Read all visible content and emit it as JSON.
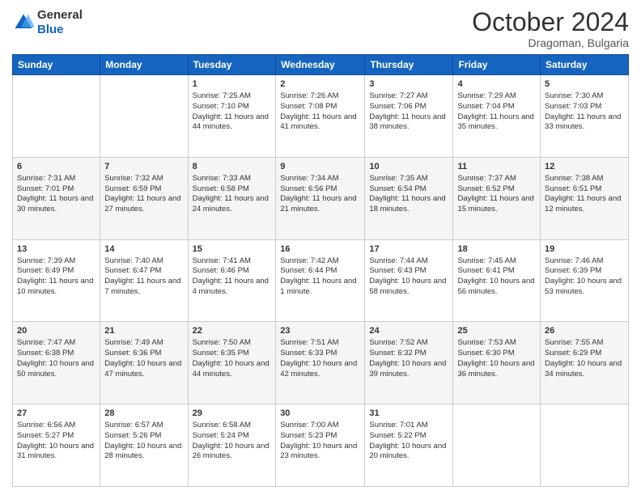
{
  "header": {
    "logo_line1": "General",
    "logo_line2": "Blue",
    "month": "October 2024",
    "location": "Dragoman, Bulgaria"
  },
  "days_of_week": [
    "Sunday",
    "Monday",
    "Tuesday",
    "Wednesday",
    "Thursday",
    "Friday",
    "Saturday"
  ],
  "weeks": [
    [
      {
        "day": "",
        "sunrise": "",
        "sunset": "",
        "daylight": ""
      },
      {
        "day": "",
        "sunrise": "",
        "sunset": "",
        "daylight": ""
      },
      {
        "day": "1",
        "sunrise": "Sunrise: 7:25 AM",
        "sunset": "Sunset: 7:10 PM",
        "daylight": "Daylight: 11 hours and 44 minutes."
      },
      {
        "day": "2",
        "sunrise": "Sunrise: 7:26 AM",
        "sunset": "Sunset: 7:08 PM",
        "daylight": "Daylight: 11 hours and 41 minutes."
      },
      {
        "day": "3",
        "sunrise": "Sunrise: 7:27 AM",
        "sunset": "Sunset: 7:06 PM",
        "daylight": "Daylight: 11 hours and 38 minutes."
      },
      {
        "day": "4",
        "sunrise": "Sunrise: 7:29 AM",
        "sunset": "Sunset: 7:04 PM",
        "daylight": "Daylight: 11 hours and 35 minutes."
      },
      {
        "day": "5",
        "sunrise": "Sunrise: 7:30 AM",
        "sunset": "Sunset: 7:03 PM",
        "daylight": "Daylight: 11 hours and 33 minutes."
      }
    ],
    [
      {
        "day": "6",
        "sunrise": "Sunrise: 7:31 AM",
        "sunset": "Sunset: 7:01 PM",
        "daylight": "Daylight: 11 hours and 30 minutes."
      },
      {
        "day": "7",
        "sunrise": "Sunrise: 7:32 AM",
        "sunset": "Sunset: 6:59 PM",
        "daylight": "Daylight: 11 hours and 27 minutes."
      },
      {
        "day": "8",
        "sunrise": "Sunrise: 7:33 AM",
        "sunset": "Sunset: 6:58 PM",
        "daylight": "Daylight: 11 hours and 24 minutes."
      },
      {
        "day": "9",
        "sunrise": "Sunrise: 7:34 AM",
        "sunset": "Sunset: 6:56 PM",
        "daylight": "Daylight: 11 hours and 21 minutes."
      },
      {
        "day": "10",
        "sunrise": "Sunrise: 7:35 AM",
        "sunset": "Sunset: 6:54 PM",
        "daylight": "Daylight: 11 hours and 18 minutes."
      },
      {
        "day": "11",
        "sunrise": "Sunrise: 7:37 AM",
        "sunset": "Sunset: 6:52 PM",
        "daylight": "Daylight: 11 hours and 15 minutes."
      },
      {
        "day": "12",
        "sunrise": "Sunrise: 7:38 AM",
        "sunset": "Sunset: 6:51 PM",
        "daylight": "Daylight: 11 hours and 12 minutes."
      }
    ],
    [
      {
        "day": "13",
        "sunrise": "Sunrise: 7:39 AM",
        "sunset": "Sunset: 6:49 PM",
        "daylight": "Daylight: 11 hours and 10 minutes."
      },
      {
        "day": "14",
        "sunrise": "Sunrise: 7:40 AM",
        "sunset": "Sunset: 6:47 PM",
        "daylight": "Daylight: 11 hours and 7 minutes."
      },
      {
        "day": "15",
        "sunrise": "Sunrise: 7:41 AM",
        "sunset": "Sunset: 6:46 PM",
        "daylight": "Daylight: 11 hours and 4 minutes."
      },
      {
        "day": "16",
        "sunrise": "Sunrise: 7:42 AM",
        "sunset": "Sunset: 6:44 PM",
        "daylight": "Daylight: 11 hours and 1 minute."
      },
      {
        "day": "17",
        "sunrise": "Sunrise: 7:44 AM",
        "sunset": "Sunset: 6:43 PM",
        "daylight": "Daylight: 10 hours and 58 minutes."
      },
      {
        "day": "18",
        "sunrise": "Sunrise: 7:45 AM",
        "sunset": "Sunset: 6:41 PM",
        "daylight": "Daylight: 10 hours and 56 minutes."
      },
      {
        "day": "19",
        "sunrise": "Sunrise: 7:46 AM",
        "sunset": "Sunset: 6:39 PM",
        "daylight": "Daylight: 10 hours and 53 minutes."
      }
    ],
    [
      {
        "day": "20",
        "sunrise": "Sunrise: 7:47 AM",
        "sunset": "Sunset: 6:38 PM",
        "daylight": "Daylight: 10 hours and 50 minutes."
      },
      {
        "day": "21",
        "sunrise": "Sunrise: 7:49 AM",
        "sunset": "Sunset: 6:36 PM",
        "daylight": "Daylight: 10 hours and 47 minutes."
      },
      {
        "day": "22",
        "sunrise": "Sunrise: 7:50 AM",
        "sunset": "Sunset: 6:35 PM",
        "daylight": "Daylight: 10 hours and 44 minutes."
      },
      {
        "day": "23",
        "sunrise": "Sunrise: 7:51 AM",
        "sunset": "Sunset: 6:33 PM",
        "daylight": "Daylight: 10 hours and 42 minutes."
      },
      {
        "day": "24",
        "sunrise": "Sunrise: 7:52 AM",
        "sunset": "Sunset: 6:32 PM",
        "daylight": "Daylight: 10 hours and 39 minutes."
      },
      {
        "day": "25",
        "sunrise": "Sunrise: 7:53 AM",
        "sunset": "Sunset: 6:30 PM",
        "daylight": "Daylight: 10 hours and 36 minutes."
      },
      {
        "day": "26",
        "sunrise": "Sunrise: 7:55 AM",
        "sunset": "Sunset: 6:29 PM",
        "daylight": "Daylight: 10 hours and 34 minutes."
      }
    ],
    [
      {
        "day": "27",
        "sunrise": "Sunrise: 6:56 AM",
        "sunset": "Sunset: 5:27 PM",
        "daylight": "Daylight: 10 hours and 31 minutes."
      },
      {
        "day": "28",
        "sunrise": "Sunrise: 6:57 AM",
        "sunset": "Sunset: 5:26 PM",
        "daylight": "Daylight: 10 hours and 28 minutes."
      },
      {
        "day": "29",
        "sunrise": "Sunrise: 6:58 AM",
        "sunset": "Sunset: 5:24 PM",
        "daylight": "Daylight: 10 hours and 26 minutes."
      },
      {
        "day": "30",
        "sunrise": "Sunrise: 7:00 AM",
        "sunset": "Sunset: 5:23 PM",
        "daylight": "Daylight: 10 hours and 23 minutes."
      },
      {
        "day": "31",
        "sunrise": "Sunrise: 7:01 AM",
        "sunset": "Sunset: 5:22 PM",
        "daylight": "Daylight: 10 hours and 20 minutes."
      },
      {
        "day": "",
        "sunrise": "",
        "sunset": "",
        "daylight": ""
      },
      {
        "day": "",
        "sunrise": "",
        "sunset": "",
        "daylight": ""
      }
    ]
  ]
}
